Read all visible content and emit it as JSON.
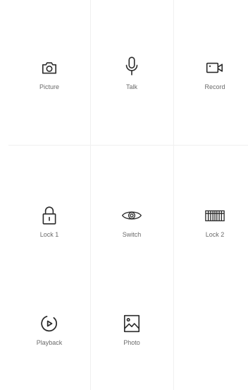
{
  "controls": {
    "picture": {
      "label": "Picture",
      "icon": "camera-icon"
    },
    "talk": {
      "label": "Talk",
      "icon": "microphone-icon"
    },
    "record": {
      "label": "Record",
      "icon": "video-camera-icon"
    },
    "lock1": {
      "label": "Lock 1",
      "icon": "padlock-icon"
    },
    "switch": {
      "label": "Switch",
      "icon": "eye-icon"
    },
    "lock2": {
      "label": "Lock 2",
      "icon": "gate-icon"
    },
    "playback": {
      "label": "Playback",
      "icon": "playback-icon"
    },
    "photo": {
      "label": "Photo",
      "icon": "image-icon"
    }
  },
  "colors": {
    "icon": "#2b2b2b",
    "label": "#6a6a6a",
    "divider": "#f0f0f0",
    "background": "#ffffff"
  }
}
